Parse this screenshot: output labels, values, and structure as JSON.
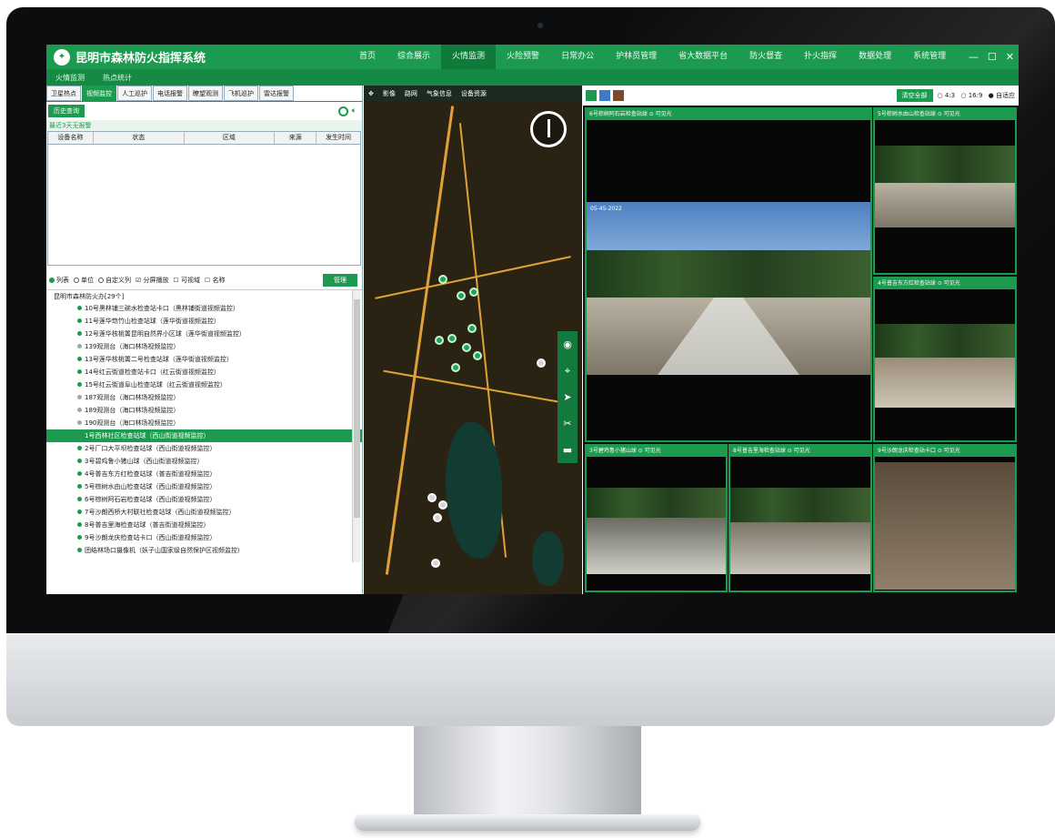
{
  "app": {
    "title": "昆明市森林防火指挥系统"
  },
  "nav": [
    "首页",
    "综合展示",
    "火情监测",
    "火险预警",
    "日常办公",
    "护林员管理",
    "省大数据平台",
    "防火督查",
    "扑火指挥",
    "数据处理",
    "系统管理"
  ],
  "nav_active": 2,
  "window_buttons": {
    "min": "—",
    "max": "☐",
    "close": "✕"
  },
  "subnav": [
    "火情监测",
    "热点统计"
  ],
  "left_tabs": [
    "卫星热点",
    "视频监控",
    "人工巡护",
    "电话报警",
    "瞭望观测",
    "飞机巡护",
    "雷达报警"
  ],
  "left_tab_active": 1,
  "history_button": "历史查询",
  "notice": "最近3天无报警",
  "alarm_table": {
    "columns": [
      "设备名称",
      "状态",
      "区域",
      "来源",
      "发生时间"
    ]
  },
  "view_options": {
    "list": "列表",
    "unit": "单位",
    "custom": "自定义列",
    "split_play": "分屏播放",
    "visible": "可视域",
    "name": "名称",
    "manage": "管理"
  },
  "tree": {
    "root": "昆明市森林防火办[29个]",
    "items": [
      "10号黑林铺三碗水检查站卡口（黑林铺街道视频监控）",
      "11号莲华筇竹山检查站球（莲华街道视频监控）",
      "12号莲华核桃箐昆明自然界小区球（莲华街道视频监控）",
      "139观测台（海口林场视频监控）",
      "13号莲华核桃箐二号检查站球（莲华街道视频监控）",
      "14号红云街道检查站卡口（红云街道视频监控）",
      "15号红云街道阜山检查站球（红云街道视频监控）",
      "187观测台（海口林场视频监控）",
      "189观测台（海口林场视频监控）",
      "190观测台（海口林场视频监控）",
      "1号西林社区检查站球（西山街道视频监控）",
      "2号厂口大平坝检查站球（西山街道视频监控）",
      "3号碧鸡鲁小猪山球（西山街道视频监控）",
      "4号普吉东方红检查站球（普吉街道视频监控）",
      "5号棕树水由山检查站球（西山街道视频监控）",
      "6号棕树阿石岩检查站球（西山街道视频监控）",
      "7号沙朗西桥大村联社检查站球（西山街道视频监控）",
      "8号普吉里海检查站球（普吉街道视频监控）",
      "9号沙朗龙庆检查站卡口（西山街道视频监控）",
      "团结林场口摄像机（妖子山国家级自然保护区视频监控）"
    ],
    "selected": 10
  },
  "map_toolbar": [
    "影像",
    "路网",
    "气象信息",
    "设备资源"
  ],
  "video": {
    "clear_button": "清空全部",
    "ratios": [
      "4:3",
      "16:9",
      "自适应"
    ],
    "panes": [
      {
        "title": "6号棕树阿石岩检查站球  ⊙ 可见光"
      },
      {
        "title": "5号棕树水由山检查站球  ⊙ 可见光"
      },
      {
        "title": "4号普吉东方红检查站球  ⊙ 可见光"
      },
      {
        "title": "3号碧鸡鲁小猪山球  ⊙ 可见光"
      },
      {
        "title": "8号普吉里海检查站球  ⊙ 可见光"
      },
      {
        "title": "9号沙朗龙庆检查站卡口  ⊙ 可见光"
      }
    ],
    "timestamp": "05-45-2022"
  },
  "colors": {
    "brand": "#1c9a4f",
    "brand_dark": "#0f7a3a"
  }
}
